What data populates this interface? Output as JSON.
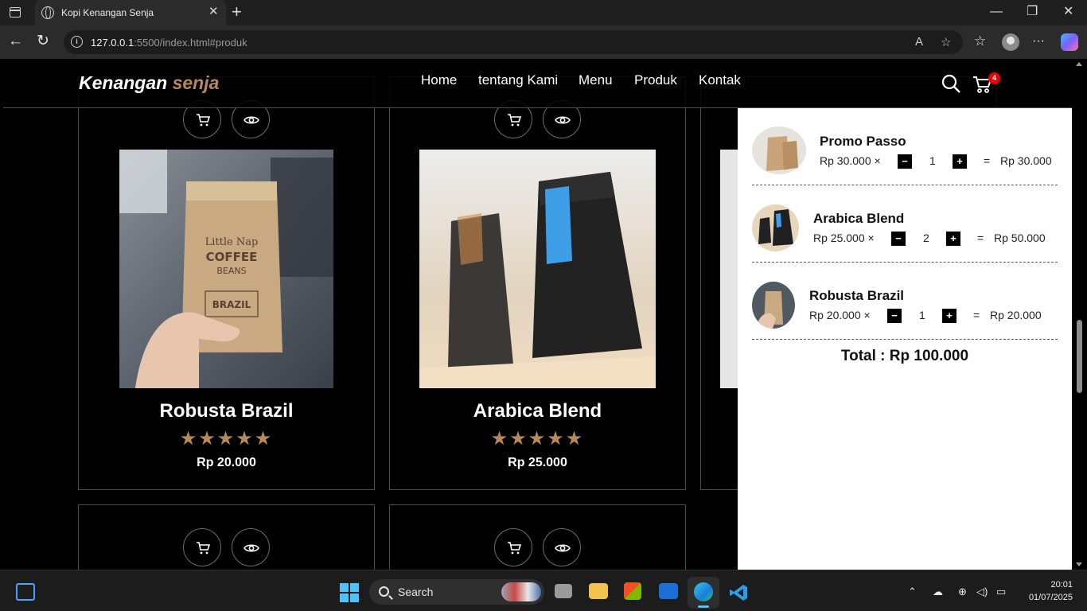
{
  "browser": {
    "tab_title": "Kopi Kenangan Senja",
    "url_host": "127.0.0.1",
    "url_rest": ":5500/index.html#produk",
    "tab_close": "✕",
    "new_tab": "+",
    "minimize": "—",
    "maximize": "❐",
    "close": "✕"
  },
  "site": {
    "logo_main": "Kenangan",
    "logo_accent": "senja",
    "nav": [
      "Home",
      "tentang Kami",
      "Menu",
      "Produk",
      "Kontak"
    ],
    "cart_count": "4"
  },
  "products": [
    {
      "name": "Robusta Brazil",
      "stars": "★★★★★",
      "price": "Rp 20.000"
    },
    {
      "name": "Arabica Blend",
      "stars": "★★★★★",
      "price": "Rp 25.000"
    }
  ],
  "cart": {
    "items": [
      {
        "name": "Promo Passo",
        "price": "Rp 30.000 ×",
        "qty": "1",
        "eq": "=",
        "subtotal": "Rp 30.000"
      },
      {
        "name": "Arabica Blend",
        "price": "Rp 25.000 ×",
        "qty": "2",
        "eq": "=",
        "subtotal": "Rp 50.000"
      },
      {
        "name": "Robusta Brazil",
        "price": "Rp 20.000 ×",
        "qty": "1",
        "eq": "=",
        "subtotal": "Rp 20.000"
      }
    ],
    "minus": "−",
    "plus": "+",
    "total": "Total : Rp 100.000"
  },
  "taskbar": {
    "search_label": "Search",
    "time": "20:01",
    "date": "01/07/2025"
  },
  "colors": {
    "accent": "#b6895b",
    "badge": "#ee0000",
    "panel": "#ffffff",
    "page_bg": "#000000"
  }
}
